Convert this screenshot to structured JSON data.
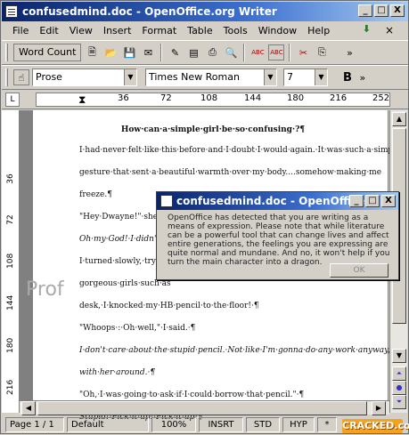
{
  "window": {
    "title": "confusedmind.doc - OpenOffice.org Writer",
    "min": "_",
    "max": "□",
    "close": "X"
  },
  "menu": [
    "File",
    "Edit",
    "View",
    "Insert",
    "Format",
    "Table",
    "Tools",
    "Window",
    "Help"
  ],
  "menu_close": "×",
  "toolbar": {
    "word_count": "Word Count",
    "spell1": "ABC",
    "spell2": "ABC",
    "more": "»"
  },
  "format": {
    "style": "Prose",
    "font": "Times New Roman",
    "size": "7",
    "bold": "B",
    "more": "»"
  },
  "ruler": {
    "corner": "L",
    "ticks": [
      "36",
      "72",
      "108",
      "144",
      "180",
      "216",
      "252"
    ]
  },
  "vruler": {
    "ticks": [
      "36",
      "72",
      "108",
      "144",
      "180",
      "216"
    ]
  },
  "document": {
    "title": "How·can·a·simple·girl·be·so·confusing·?¶",
    "lines": [
      "I·had·never·felt·like·this·before·and·I·doubt·I·would·again.·It·was·such·a·simple",
      "gesture·that·sent·a·beautiful·warmth·over·my·body....somehow·making·me",
      "freeze.¶",
      "\"Hey·Dwayne!\"·she·s",
      "Oh·my·God!·I·didn't·evi",
      "I·turned·slowly,·trying",
      "gorgeous·girls·such·as",
      "desk,·I·knocked·my·HB·pencil·to·the·floor!·¶",
      "\"Whoops·:·Oh·well,\"·I·said.·¶",
      "I·don't·care·about·the·stupid·pencil.·Not·like·I'm·gonna·do·any·work·anyway,",
      "with·her·around.·¶",
      "\"Oh,·I·was·going·to·ask·if·I·could·borrow·that·pencil.\"·¶",
      "Stupid!·Pick·it·up!·Pick·it·up!¶"
    ],
    "bg_text": "Prof"
  },
  "dialog": {
    "title": "confusedmind.doc - OpenOffice...",
    "message": "OpenOffice has detected that you are writing as a means of expression. Please note that while literature can be a powerful tool that can change lives and affect entire generations, the feelings you are expressing are quite normal and mundane. And no, it won't help if you turn the main character into a dragon.",
    "ok": "OK"
  },
  "status": {
    "page": "Page 1 / 1",
    "style": "Default",
    "zoom": "100%",
    "mode": "INSRT",
    "sel": "STD",
    "hyp": "HYP",
    "mod": "*"
  },
  "watermark": "CRACKED.com"
}
